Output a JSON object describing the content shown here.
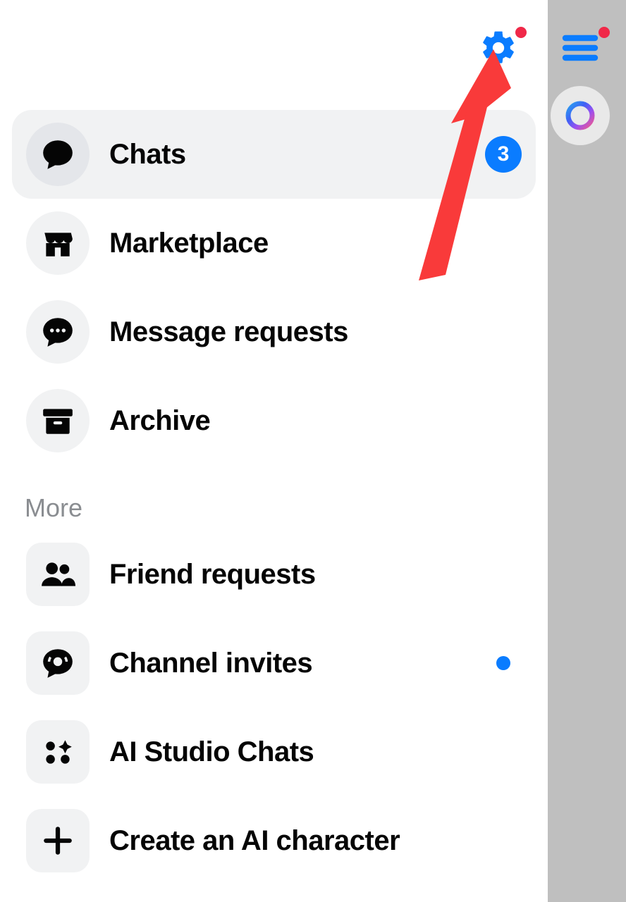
{
  "header": {
    "settings_has_notification": true
  },
  "nav": {
    "items": [
      {
        "id": "chats",
        "label": "Chats",
        "icon": "chat-bubble-icon",
        "selected": true,
        "badge_count": 3
      },
      {
        "id": "marketplace",
        "label": "Marketplace",
        "icon": "marketplace-icon"
      },
      {
        "id": "message-requests",
        "label": "Message requests",
        "icon": "message-requests-icon"
      },
      {
        "id": "archive",
        "label": "Archive",
        "icon": "archive-icon"
      }
    ]
  },
  "more": {
    "section_label": "More",
    "items": [
      {
        "id": "friend-requests",
        "label": "Friend requests",
        "icon": "people-icon"
      },
      {
        "id": "channel-invites",
        "label": "Channel invites",
        "icon": "channel-icon",
        "dot": true
      },
      {
        "id": "ai-studio",
        "label": "AI Studio Chats",
        "icon": "ai-studio-icon"
      },
      {
        "id": "create-ai",
        "label": "Create an AI character",
        "icon": "plus-icon"
      }
    ]
  },
  "right_pane": {
    "menu_has_notification": true
  },
  "annotation": {
    "type": "arrow",
    "points_to": "settings-button",
    "color": "#f93a3a"
  }
}
